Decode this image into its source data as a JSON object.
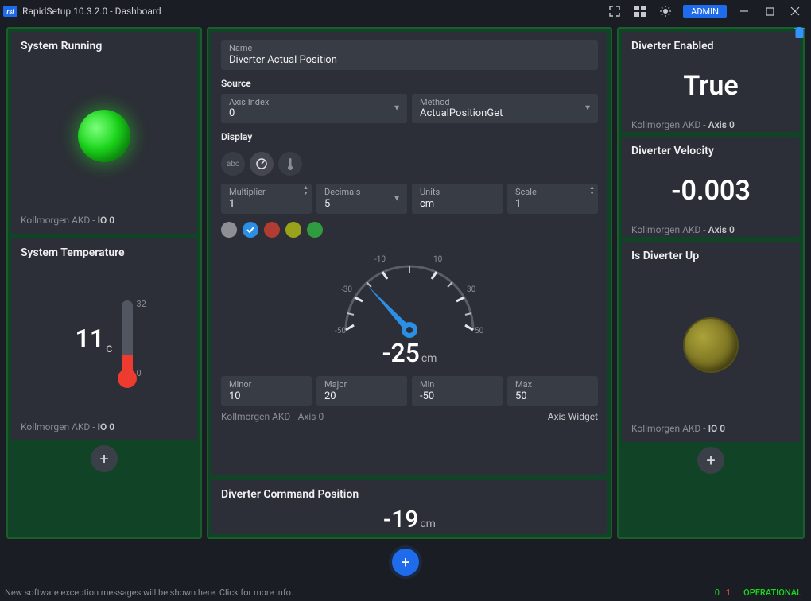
{
  "titlebar": {
    "title": "RapidSetup 10.3.2.0 - Dashboard",
    "admin": "ADMIN"
  },
  "left_column": {
    "system_running": {
      "title": "System Running",
      "footer_prefix": "Kollmorgen AKD - ",
      "footer_bold": "IO 0"
    },
    "system_temperature": {
      "title": "System Temperature",
      "value": "11",
      "unit": "c",
      "scale_high": "32",
      "scale_low": "0",
      "footer_prefix": "Kollmorgen AKD - ",
      "footer_bold": "IO 0"
    }
  },
  "mid_column": {
    "config": {
      "name_label": "Name",
      "name_value": "Diverter Actual Position",
      "source_label": "Source",
      "axis_label": "Axis Index",
      "axis_value": "0",
      "method_label": "Method",
      "method_value": "ActualPositionGet",
      "display_label": "Display",
      "multiplier_label": "Multiplier",
      "multiplier_value": "1",
      "decimals_label": "Decimals",
      "decimals_value": "5",
      "units_label": "Units",
      "units_value": "cm",
      "scale_label": "Scale",
      "scale_value": "1",
      "gauge_value": "-25",
      "gauge_unit": "cm",
      "minor_label": "Minor",
      "minor_value": "10",
      "major_label": "Major",
      "major_value": "20",
      "min_label": "Min",
      "min_value": "-50",
      "max_label": "Max",
      "max_value": "50",
      "ticks": {
        "n50": "-50",
        "n30": "-30",
        "n10": "-10",
        "p10": "10",
        "p30": "30",
        "p50": "50"
      },
      "footer_prefix": "Kollmorgen AKD - ",
      "footer_bold": "Axis 0",
      "footer_right": "Axis Widget"
    },
    "command": {
      "title": "Diverter Command Position",
      "value": "-19",
      "unit": "cm"
    }
  },
  "right_column": {
    "diverter_enabled": {
      "title": "Diverter Enabled",
      "value": "True",
      "footer_prefix": "Kollmorgen AKD - ",
      "footer_bold": "Axis 0"
    },
    "diverter_velocity": {
      "title": "Diverter Velocity",
      "value": "-0.003",
      "footer_prefix": "Kollmorgen AKD - ",
      "footer_bold": "Axis 0"
    },
    "is_diverter_up": {
      "title": "Is Diverter Up",
      "footer_prefix": "Kollmorgen AKD - ",
      "footer_bold": "IO 0"
    }
  },
  "statusbar": {
    "msg": "New software exception messages will be shown here. Click for more info.",
    "green": "0",
    "red": "1",
    "state": "OPERATIONAL"
  },
  "chart_data": {
    "type": "gauge",
    "title": "Diverter Actual Position",
    "unit": "cm",
    "value": -25,
    "min": -50,
    "max": 50,
    "major_step": 20,
    "minor_step": 10,
    "ticks": [
      -50,
      -30,
      -10,
      10,
      30,
      50
    ],
    "multiplier": 1,
    "decimals": 5,
    "scale": 1
  }
}
